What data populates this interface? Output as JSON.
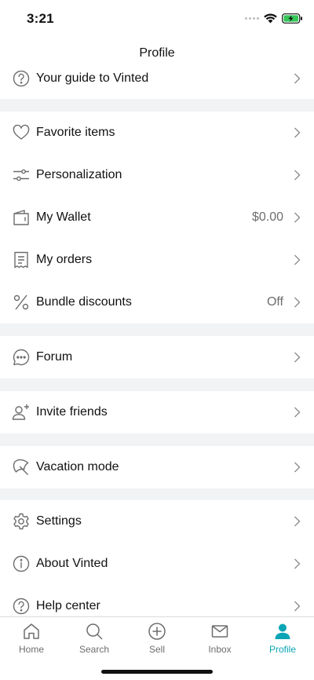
{
  "status_bar": {
    "time": "3:21"
  },
  "header": {
    "title": "Profile"
  },
  "menu": {
    "guide": {
      "label": "Your guide to Vinted",
      "icon": "question-circle-icon"
    },
    "favorites": {
      "label": "Favorite items",
      "icon": "heart-icon"
    },
    "personalization": {
      "label": "Personalization",
      "icon": "sliders-icon"
    },
    "wallet": {
      "label": "My Wallet",
      "value": "$0.00",
      "icon": "wallet-icon"
    },
    "orders": {
      "label": "My orders",
      "icon": "receipt-icon"
    },
    "bundle": {
      "label": "Bundle discounts",
      "value": "Off",
      "icon": "percent-icon"
    },
    "forum": {
      "label": "Forum",
      "icon": "chat-bubble-icon"
    },
    "invite": {
      "label": "Invite friends",
      "icon": "add-user-icon"
    },
    "vacation": {
      "label": "Vacation mode",
      "icon": "umbrella-icon"
    },
    "settings": {
      "label": "Settings",
      "icon": "gear-icon"
    },
    "about": {
      "label": "About Vinted",
      "icon": "info-circle-icon"
    },
    "help": {
      "label": "Help center",
      "icon": "question-circle-icon"
    }
  },
  "tab_bar": {
    "items": [
      {
        "label": "Home",
        "icon": "home-icon",
        "active": false
      },
      {
        "label": "Search",
        "icon": "search-icon",
        "active": false
      },
      {
        "label": "Sell",
        "icon": "plus-circle-icon",
        "active": false
      },
      {
        "label": "Inbox",
        "icon": "mail-icon",
        "active": false
      },
      {
        "label": "Profile",
        "icon": "person-icon",
        "active": true
      }
    ]
  },
  "colors": {
    "accent": "#09a5b4",
    "section_gap": "#f2f3f5",
    "icon_gray": "#6d6d6d",
    "battery_green": "#34c759"
  }
}
